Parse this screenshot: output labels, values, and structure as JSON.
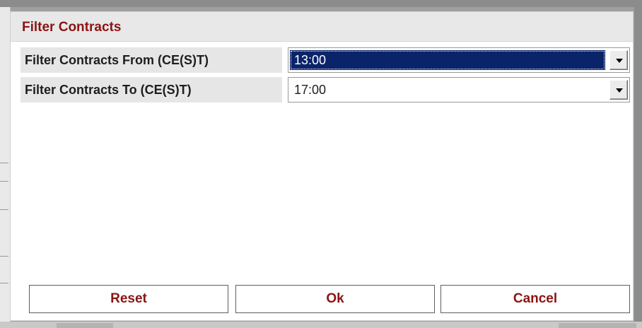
{
  "dialog": {
    "title": "Filter Contracts",
    "fields": [
      {
        "label": "Filter Contracts From (CE(S)T)",
        "value": "13:00",
        "selected": true
      },
      {
        "label": "Filter Contracts To (CE(S)T)",
        "value": "17:00",
        "selected": false
      }
    ],
    "buttons": {
      "reset": "Reset",
      "ok": "Ok",
      "cancel": "Cancel"
    }
  },
  "colors": {
    "title_text": "#8b1414",
    "selected_highlight": "#0a246a",
    "label_background": "#e6e6e6"
  },
  "icons": {
    "dropdown_arrow": "chevron-down-icon"
  }
}
